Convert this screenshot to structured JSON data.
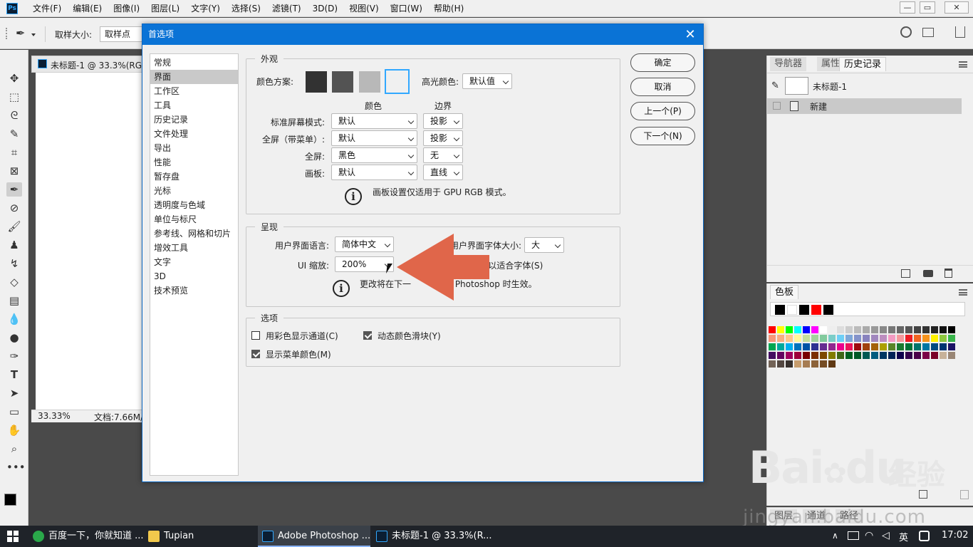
{
  "app": {
    "logo": "Ps",
    "menu": [
      "文件(F)",
      "编辑(E)",
      "图像(I)",
      "图层(L)",
      "文字(Y)",
      "选择(S)",
      "滤镜(T)",
      "3D(D)",
      "视图(V)",
      "窗口(W)",
      "帮助(H)"
    ]
  },
  "options_bar": {
    "sample_size_label": "取样大小:",
    "sample_size_value": "取样点"
  },
  "document": {
    "tab_title": "未标题-1 @ 33.3%(RG",
    "zoom": "33.33%",
    "doc_info": "文档:7.66M/"
  },
  "dialog": {
    "title": "首选项",
    "categories": [
      "常规",
      "界面",
      "工作区",
      "工具",
      "历史记录",
      "文件处理",
      "导出",
      "性能",
      "暂存盘",
      "光标",
      "透明度与色域",
      "单位与标尺",
      "参考线、网格和切片",
      "增效工具",
      "文字",
      "3D",
      "技术预览"
    ],
    "selected_category": "界面",
    "appearance": {
      "title": "外观",
      "color_scheme_label": "颜色方案:",
      "highlight_label": "高光颜色:",
      "highlight_value": "默认值",
      "col_color": "颜色",
      "col_border": "边界",
      "rows": [
        {
          "label": "标准屏幕模式:",
          "color": "默认",
          "border": "投影"
        },
        {
          "label": "全屏（带菜单）:",
          "color": "默认",
          "border": "投影"
        },
        {
          "label": "全屏:",
          "color": "黑色",
          "border": "无"
        },
        {
          "label": "画板:",
          "color": "默认",
          "border": "直线"
        }
      ],
      "note": "画板设置仅适用于 GPU RGB 模式。"
    },
    "presentation": {
      "title": "呈现",
      "language_label": "用户界面语言:",
      "language_value": "简体中文",
      "font_size_label": "用户界面字体大小:",
      "font_size_value": "大",
      "scale_label": "UI 缩放:",
      "scale_value": "200%",
      "scale_fit_label": "I 以适合字体(S)",
      "note_a": "更改将在下一",
      "note_b": "动 Photoshop 时生效。"
    },
    "options": {
      "title": "选项",
      "show_channels_color": "用彩色显示通道(C)",
      "dynamic_sliders": "动态颜色滑块(Y)",
      "show_menu_colors": "显示菜单颜色(M)"
    },
    "buttons": {
      "ok": "确定",
      "cancel": "取消",
      "prev": "上一个(P)",
      "next": "下一个(N)"
    }
  },
  "panels": {
    "top_tabs": [
      "导航器",
      "属性",
      "历史记录"
    ],
    "history_snapshot": "未标题-1",
    "history_item": "新建",
    "swatches_tab": "色板",
    "bottom_tabs": [
      "图层",
      "通道",
      "路径"
    ]
  },
  "taskbar": {
    "items": [
      "百度一下，你就知道 ...",
      "Tupian",
      "Adobe Photoshop ...",
      "未标题-1 @ 33.3%(R..."
    ],
    "ime": "英",
    "clock": "17:02"
  },
  "watermark": {
    "brand": "Bai",
    "brand_suffix": "du",
    "cn": "经验",
    "url": "jingyan.baidu.com"
  },
  "colors": {
    "accent": "#0a73d6",
    "arrow": "#e0664a",
    "scheme": [
      "#323232",
      "#535353",
      "#b8b8b8",
      "#f0f0f0"
    ]
  }
}
